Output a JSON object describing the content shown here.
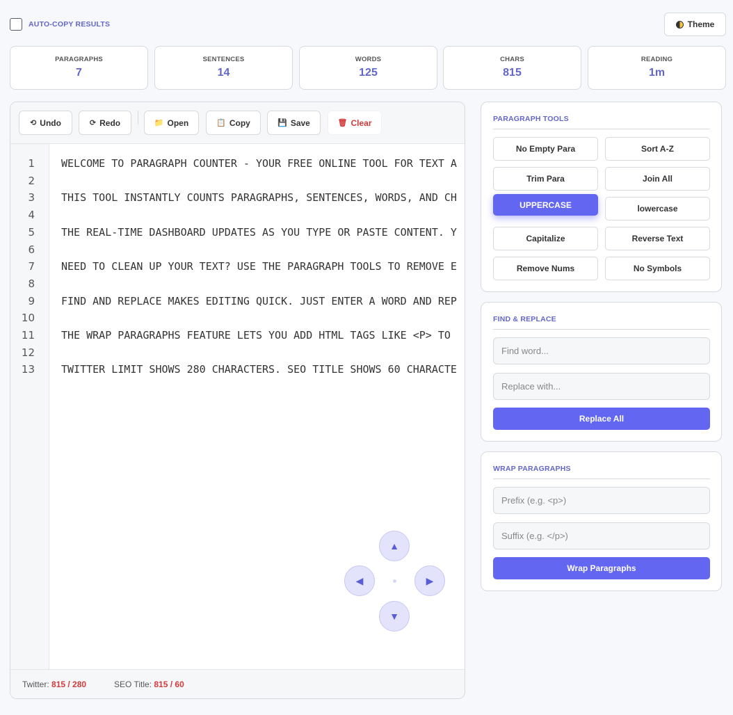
{
  "header": {
    "auto_copy_label": "AUTO-COPY RESULTS",
    "auto_copy_checked": false,
    "theme_label": "Theme"
  },
  "stats": [
    {
      "label": "PARAGRAPHS",
      "value": "7"
    },
    {
      "label": "SENTENCES",
      "value": "14"
    },
    {
      "label": "WORDS",
      "value": "125"
    },
    {
      "label": "CHARS",
      "value": "815"
    },
    {
      "label": "READING",
      "value": "1m"
    }
  ],
  "toolbar": {
    "undo": "Undo",
    "redo": "Redo",
    "open": "Open",
    "copy": "Copy",
    "save": "Save",
    "clear": "Clear"
  },
  "editor": {
    "line_numbers": [
      "1",
      "2",
      "3",
      "4",
      "5",
      "6",
      "7",
      "8",
      "9",
      "10",
      "11",
      "12",
      "13"
    ],
    "lines": [
      "WELCOME TO PARAGRAPH COUNTER - YOUR FREE ONLINE TOOL FOR TEXT A",
      "",
      "THIS TOOL INSTANTLY COUNTS PARAGRAPHS, SENTENCES, WORDS, AND CH",
      "",
      "THE REAL-TIME DASHBOARD UPDATES AS YOU TYPE OR PASTE CONTENT. Y",
      "",
      "NEED TO CLEAN UP YOUR TEXT? USE THE PARAGRAPH TOOLS TO REMOVE E",
      "",
      "FIND AND REPLACE MAKES EDITING QUICK. JUST ENTER A WORD AND REP",
      "",
      "THE WRAP PARAGRAPHS FEATURE LETS YOU ADD HTML TAGS LIKE <P> TO",
      "",
      "TWITTER LIMIT SHOWS 280 CHARACTERS. SEO TITLE SHOWS 60 CHARACTE"
    ]
  },
  "footer": {
    "twitter_label": "Twitter:",
    "twitter_value": "815 / 280",
    "seo_label": "SEO Title:",
    "seo_value": "815 / 60"
  },
  "paragraph_tools": {
    "title": "PARAGRAPH TOOLS",
    "buttons": [
      "No Empty Para",
      "Sort A-Z",
      "Trim Para",
      "Join All",
      "UPPERCASE",
      "lowercase",
      "Capitalize",
      "Reverse Text",
      "Remove Nums",
      "No Symbols"
    ],
    "active": "UPPERCASE"
  },
  "find_replace": {
    "title": "FIND & REPLACE",
    "find_placeholder": "Find word...",
    "replace_placeholder": "Replace with...",
    "button": "Replace All"
  },
  "wrap": {
    "title": "WRAP PARAGRAPHS",
    "prefix_placeholder": "Prefix (e.g. <p>)",
    "suffix_placeholder": "Suffix (e.g. </p>)",
    "button": "Wrap Paragraphs"
  },
  "colors": {
    "accent": "#6366f1",
    "accent_text": "#6366c9",
    "danger": "#d33a3a"
  },
  "icons": {
    "undo": "undo-icon",
    "redo": "redo-icon",
    "open": "folder-icon",
    "copy": "clipboard-icon",
    "save": "floppy-disk-icon",
    "clear": "trash-icon",
    "theme": "half-moon-icon"
  }
}
